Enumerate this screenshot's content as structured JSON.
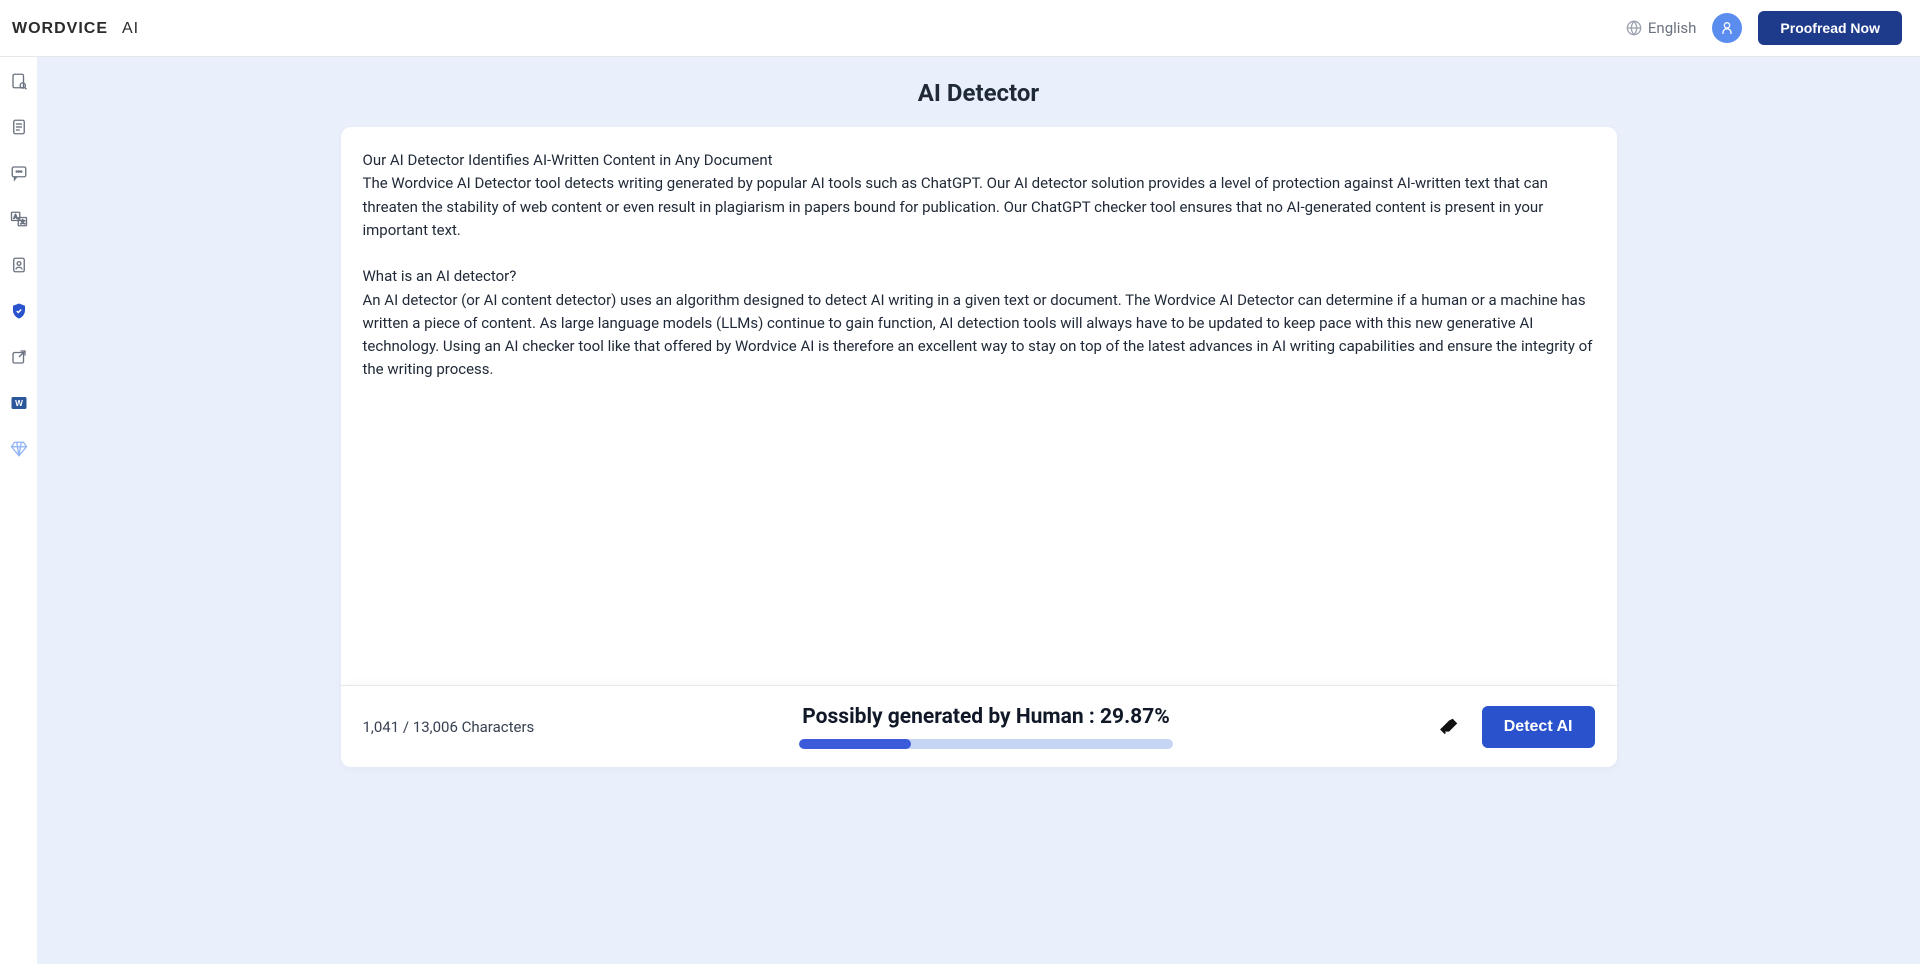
{
  "header": {
    "logo_text": "WORDVICE AI",
    "language_label": "English",
    "avatar_glyph": "유",
    "proofread_label": "Proofread Now"
  },
  "page": {
    "title": "AI Detector"
  },
  "editor": {
    "h1": "Our AI Detector Identifies AI-Written Content in Any Document",
    "p1": "The Wordvice AI Detector tool detects writing generated by popular AI tools such as ChatGPT. Our AI detector solution provides a level of protection against AI-written text that can threaten the stability of web content or even result in plagiarism in papers bound for publication. Our ChatGPT checker tool ensures that no AI-generated content is present in your important text.",
    "h2": "What is an AI detector?",
    "p2": "An AI detector (or AI content detector) uses an algorithm designed to detect AI writing in a given text or document. The Wordvice AI Detector can determine if a human or a machine has written a piece of content. As large language models (LLMs) continue to gain function, AI detection tools will always have to be updated to keep pace with this new generative AI technology. Using an AI checker tool like that offered by Wordvice AI is therefore an excellent way to stay on top of the latest advances in AI writing capabilities and ensure the integrity of the writing process."
  },
  "status": {
    "char_count_text": "1,041 / 13,006 Characters",
    "result_prefix": "Possibly generated by Human : ",
    "result_value": "29.87%",
    "progress_percent": 29.87,
    "detect_label": "Detect AI"
  },
  "icons": {
    "globe": "globe-icon"
  }
}
